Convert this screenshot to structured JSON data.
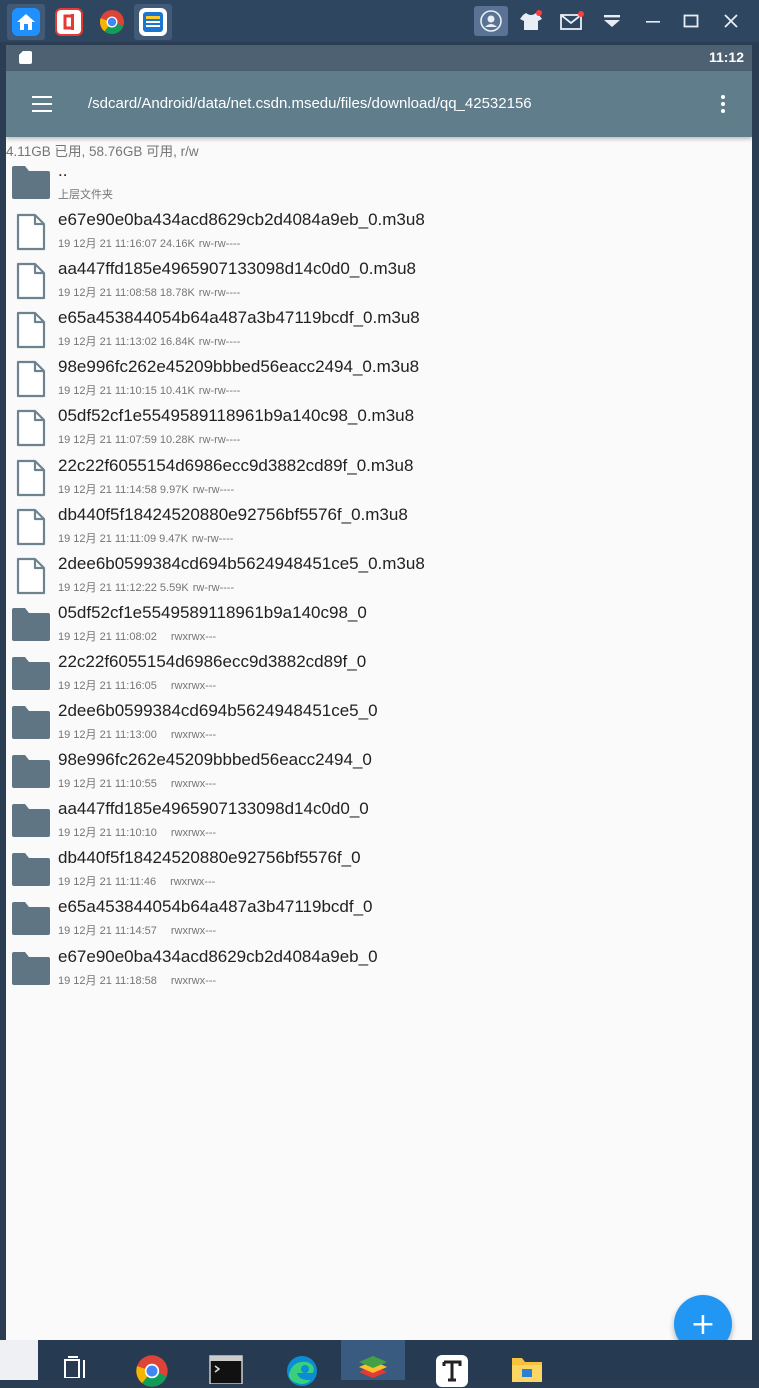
{
  "emulator": {
    "tabs": [
      {
        "name": "home-tab",
        "icon": "home-icon"
      },
      {
        "name": "csdn-tab",
        "icon": "csdn-app-icon"
      },
      {
        "name": "chrome-tab",
        "icon": "chrome-icon"
      },
      {
        "name": "file-manager-tab",
        "icon": "file-manager-icon"
      }
    ],
    "controls": [
      "account-icon",
      "shirt-icon",
      "mail-icon",
      "dropdown-icon",
      "minimize-icon",
      "maximize-icon",
      "close-icon"
    ]
  },
  "status_bar": {
    "time": "11:12",
    "icon": "sd-card-icon"
  },
  "app_bar": {
    "path": "/sdcard/Android/data/net.csdn.msedu/files/download/qq_42532156",
    "menu_icon": "hamburger-menu-icon",
    "overflow_icon": "more-vert-icon"
  },
  "storage_info": "4.11GB 已用, 58.76GB 可用, r/w",
  "entries": [
    {
      "type": "folder",
      "name": "..",
      "meta": "上层文件夹",
      "perm": ""
    },
    {
      "type": "file",
      "name": "e67e90e0ba434acd8629cb2d4084a9eb_0.m3u8",
      "meta": "19 12月 21 11:16:07  24.16K",
      "perm": "rw-rw----"
    },
    {
      "type": "file",
      "name": "aa447ffd185e4965907133098d14c0d0_0.m3u8",
      "meta": "19 12月 21 11:08:58  18.78K",
      "perm": "rw-rw----"
    },
    {
      "type": "file",
      "name": "e65a453844054b64a487a3b47119bcdf_0.m3u8",
      "meta": "19 12月 21 11:13:02  16.84K",
      "perm": "rw-rw----"
    },
    {
      "type": "file",
      "name": "98e996fc262e45209bbbed56eacc2494_0.m3u8",
      "meta": "19 12月 21 11:10:15  10.41K",
      "perm": "rw-rw----"
    },
    {
      "type": "file",
      "name": "05df52cf1e5549589118961b9a140c98_0.m3u8",
      "meta": "19 12月 21 11:07:59  10.28K",
      "perm": "rw-rw----"
    },
    {
      "type": "file",
      "name": "22c22f6055154d6986ecc9d3882cd89f_0.m3u8",
      "meta": "19 12月 21 11:14:58  9.97K",
      "perm": "rw-rw----"
    },
    {
      "type": "file",
      "name": "db440f5f18424520880e92756bf5576f_0.m3u8",
      "meta": "19 12月 21 11:11:09  9.47K",
      "perm": "rw-rw----"
    },
    {
      "type": "file",
      "name": "2dee6b0599384cd694b5624948451ce5_0.m3u8",
      "meta": "19 12月 21 11:12:22  5.59K",
      "perm": "rw-rw----"
    },
    {
      "type": "folder",
      "name": "05df52cf1e5549589118961b9a140c98_0",
      "meta": "19 12月 21 11:08:02",
      "perm": "rwxrwx---"
    },
    {
      "type": "folder",
      "name": "22c22f6055154d6986ecc9d3882cd89f_0",
      "meta": "19 12月 21 11:16:05",
      "perm": "rwxrwx---"
    },
    {
      "type": "folder",
      "name": "2dee6b0599384cd694b5624948451ce5_0",
      "meta": "19 12月 21 11:13:00",
      "perm": "rwxrwx---"
    },
    {
      "type": "folder",
      "name": "98e996fc262e45209bbbed56eacc2494_0",
      "meta": "19 12月 21 11:10:55",
      "perm": "rwxrwx---"
    },
    {
      "type": "folder",
      "name": "aa447ffd185e4965907133098d14c0d0_0",
      "meta": "19 12月 21 11:10:10",
      "perm": "rwxrwx---"
    },
    {
      "type": "folder",
      "name": "db440f5f18424520880e92756bf5576f_0",
      "meta": "19 12月 21 11:11:46",
      "perm": "rwxrwx---"
    },
    {
      "type": "folder",
      "name": "e65a453844054b64a487a3b47119bcdf_0",
      "meta": "19 12月 21 11:14:57",
      "perm": "rwxrwx---"
    },
    {
      "type": "folder",
      "name": "e67e90e0ba434acd8629cb2d4084a9eb_0",
      "meta": "19 12月 21 11:18:58",
      "perm": "rwxrwx---"
    }
  ],
  "fab": {
    "label": "+",
    "icon": "add-icon"
  },
  "taskbar": {
    "items": [
      "task-view-icon",
      "chrome-icon",
      "terminal-icon",
      "edge-icon",
      "bluestacks-icon",
      "typora-icon",
      "file-explorer-icon"
    ]
  },
  "colors": {
    "app_bar": "#607d8b",
    "status_bar": "#4e6172",
    "folder": "#5f7583",
    "fab": "#2196f3",
    "emulator_bar": "#2f4661",
    "taskbar": "#263a52"
  }
}
